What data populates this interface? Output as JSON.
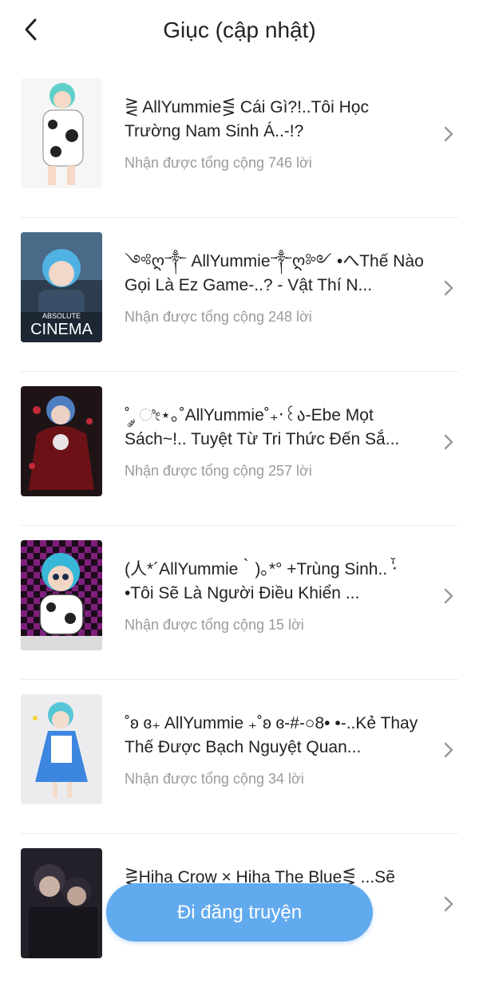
{
  "header": {
    "title": "Giục (cập nhật)",
    "back_icon": "chevron-left-icon"
  },
  "items": [
    {
      "title": "⋛ AllYummie⋚ Cái Gì?!..Tôi Học Trường Nam Sinh Á..-!?",
      "stat": "Nhận được tổng cộng 746 lời"
    },
    {
      "title": "༺ღ༒ AllYummie༒ღ༻ •へThế Nào Gọi Là Ez Game-..? - Vật Thí N...",
      "stat": "Nhận được tổng cộng 248 lời"
    },
    {
      "title": "˚ ༘ ೀ⋆｡˚AllYummie˚₊‧꒰ა-Ebe Mọt Sách~!.. Tuyệt Từ Tri Thức Đến Sắ...",
      "stat": "Nhận được tổng cộng 257 lời"
    },
    {
      "title": "(人*´AllYummie｀)｡*° +Trùng Sinh.. ‧̍̊•Tôi Sẽ Là Người Điều Khiển ...",
      "stat": "Nhận được tổng cộng 15 lời"
    },
    {
      "title": "˚ʚ ɞ₊ AllYummie ₊˚ʚ ɞ-#-○8• •-..Kẻ Thay Thế Được Bạch Nguyệt Quan...",
      "stat": "Nhận được tổng cộng 34 lời"
    },
    {
      "title": "⋛Hiha Crow × Hiha The Blue⋚ ...Sẽ Yê...",
      "stat": ""
    }
  ],
  "chevron_icon": "chevron-right-icon",
  "post_button": {
    "label": "Đi đăng truyện"
  },
  "colors": {
    "accent": "#62aaee",
    "muted": "#9a9a9a",
    "divider": "#ececec"
  }
}
